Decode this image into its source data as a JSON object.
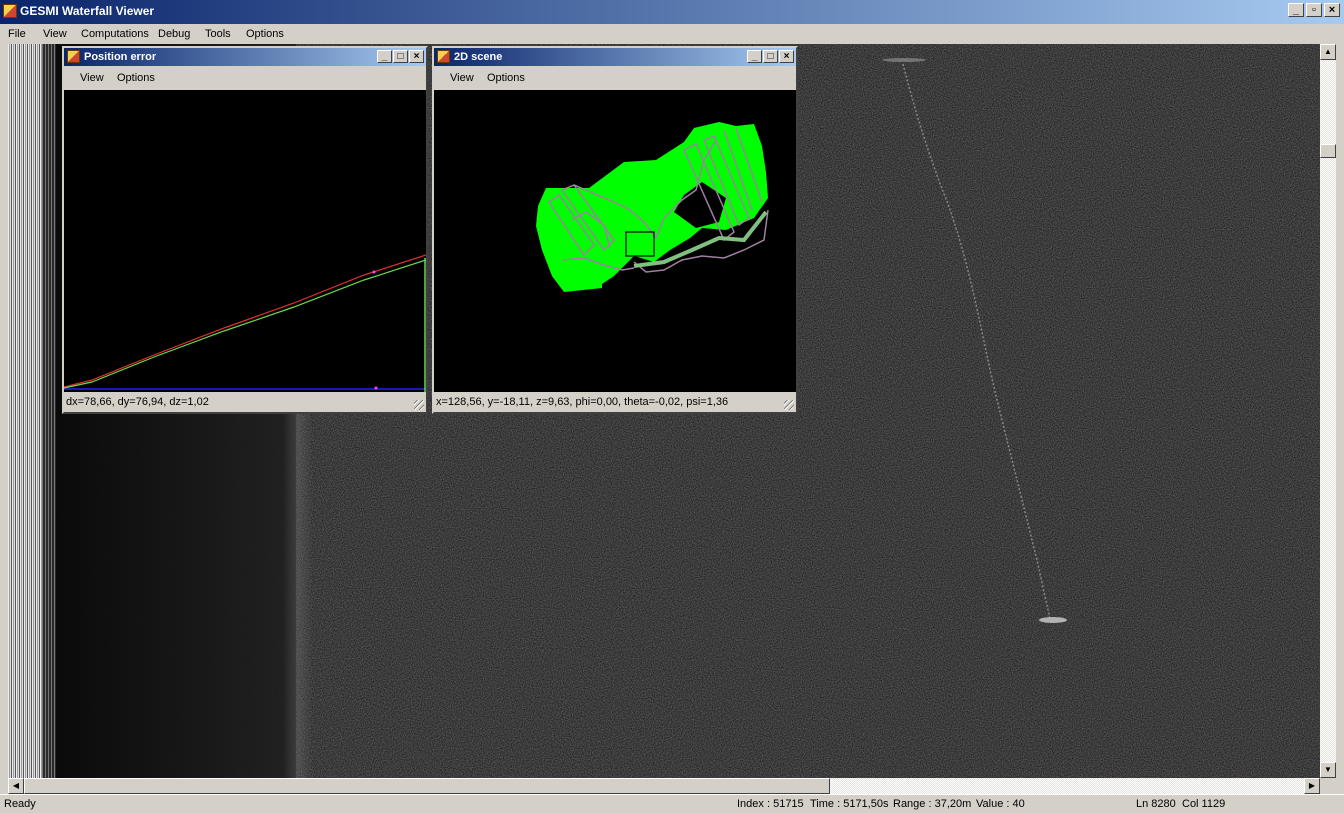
{
  "app": {
    "title": "GESMI Waterfall Viewer",
    "window_buttons": {
      "minimize": "_",
      "restore": "̅",
      "close": "X"
    }
  },
  "menu": [
    "File",
    "View",
    "Computations",
    "Debug",
    "Tools",
    "Options"
  ],
  "position_error_window": {
    "title": "Position error",
    "menu": [
      "View",
      "Options"
    ],
    "status": "dx=78,66, dy=76,94, dz=1,02"
  },
  "scene_window": {
    "title": "2D scene",
    "menu": [
      "View",
      "Options"
    ],
    "status": "x=128,56, y=-18,11, z=9,63, phi=0,00, theta=-0,02, psi=1,36"
  },
  "statusbar": {
    "state": "Ready",
    "index": "Index : 51715",
    "time": "Time : 5171,50s",
    "range": "Range : 37,20m",
    "value": "Value : 40",
    "ln": "Ln 8280",
    "col": "Col 1129"
  },
  "colors": {
    "title_gradient_start": "#0a246a",
    "title_gradient_end": "#a6caf0",
    "chrome": "#d4d0c8",
    "plot_green": "#6cd84a",
    "plot_red": "#e03030",
    "plot_blue": "#2020ff",
    "scene_green": "#00ff00",
    "scene_track": "#a080a0"
  },
  "icons": {
    "app": "app-icon",
    "minimize": "minimize-icon",
    "maximize": "maximize-icon",
    "close": "close-icon"
  }
}
